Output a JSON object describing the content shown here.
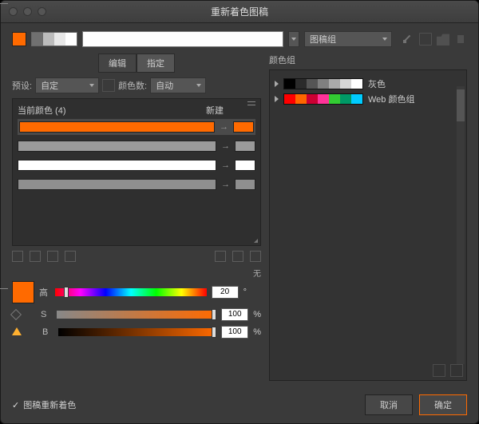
{
  "window": {
    "title": "重新着色图稿"
  },
  "top": {
    "swatch": "#ff6a00",
    "bars": [
      "#707070",
      "#bcbcbc",
      "#e8e8e8",
      "#ffffff"
    ],
    "group_select": "图稿组"
  },
  "tabs": {
    "edit": "编辑",
    "assign": "指定"
  },
  "preset": {
    "label": "预设:",
    "value": "自定",
    "count_label": "颜色数:",
    "count_value": "自动"
  },
  "colorsbox": {
    "current_label": "当前颜色 (4)",
    "new_label": "新建",
    "rows": [
      {
        "bar": "#ff6a00",
        "sw": "#ff6a00"
      },
      {
        "bar": "#9a9a9a",
        "sw": "#9a9a9a"
      },
      {
        "bar": "#ffffff",
        "sw": "#ffffff"
      },
      {
        "bar": "#8f8f8f",
        "sw": "#8f8f8f"
      }
    ]
  },
  "none_label": "无",
  "hsb": {
    "h": {
      "label": "高",
      "value": "20",
      "unit": "°"
    },
    "s": {
      "label": "S",
      "value": "100",
      "unit": "%"
    },
    "b": {
      "label": "B",
      "value": "100",
      "unit": "%"
    }
  },
  "right": {
    "title": "颜色组",
    "groups": [
      {
        "name": "灰色",
        "colors": [
          "#000",
          "#2b2b2b",
          "#555",
          "#808080",
          "#aaa",
          "#d5d5d5",
          "#fff"
        ]
      },
      {
        "name": "Web 颜色组",
        "colors": [
          "#ff0000",
          "#ff6600",
          "#cc0033",
          "#ff3399",
          "#33cc33",
          "#009966",
          "#00ccff"
        ]
      }
    ]
  },
  "footer": {
    "recolor": "图稿重新着色",
    "cancel": "取消",
    "ok": "确定"
  }
}
